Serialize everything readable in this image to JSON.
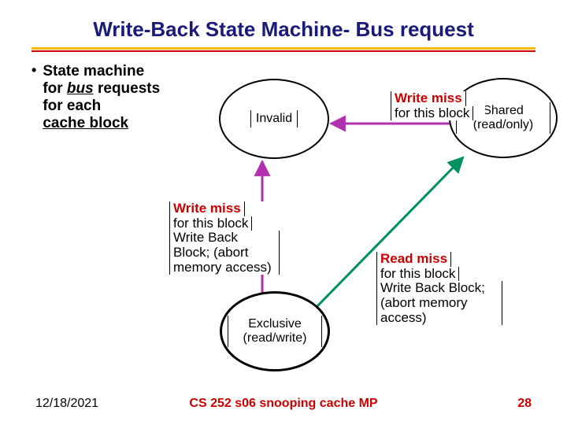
{
  "title": "Write-Back State Machine- Bus request",
  "bullet": {
    "line1": "State machine",
    "line2a": "for ",
    "line2b": "bus",
    "line2c": " requests",
    "line3": " for each",
    "line4": "cache block"
  },
  "states": {
    "invalid": "Invalid",
    "shared": "Shared (read/only)",
    "exclusive": "Exclusive (read/write)"
  },
  "labels": {
    "top_red": "Write miss",
    "top_sub": "for this block",
    "left_red": "Write miss",
    "left_sub": "for this block",
    "left_action": "Write Back Block; (abort memory access)",
    "right_red": "Read miss",
    "right_sub": "for this block",
    "right_action": "Write Back Block; (abort memory access)"
  },
  "footer": {
    "date": "12/18/2021",
    "center": "CS 252 s06 snooping cache MP",
    "page": "28"
  },
  "colors": {
    "magenta": "#b030b0",
    "green": "#009060",
    "red": "#c00000",
    "navy": "#1a1a7a"
  }
}
